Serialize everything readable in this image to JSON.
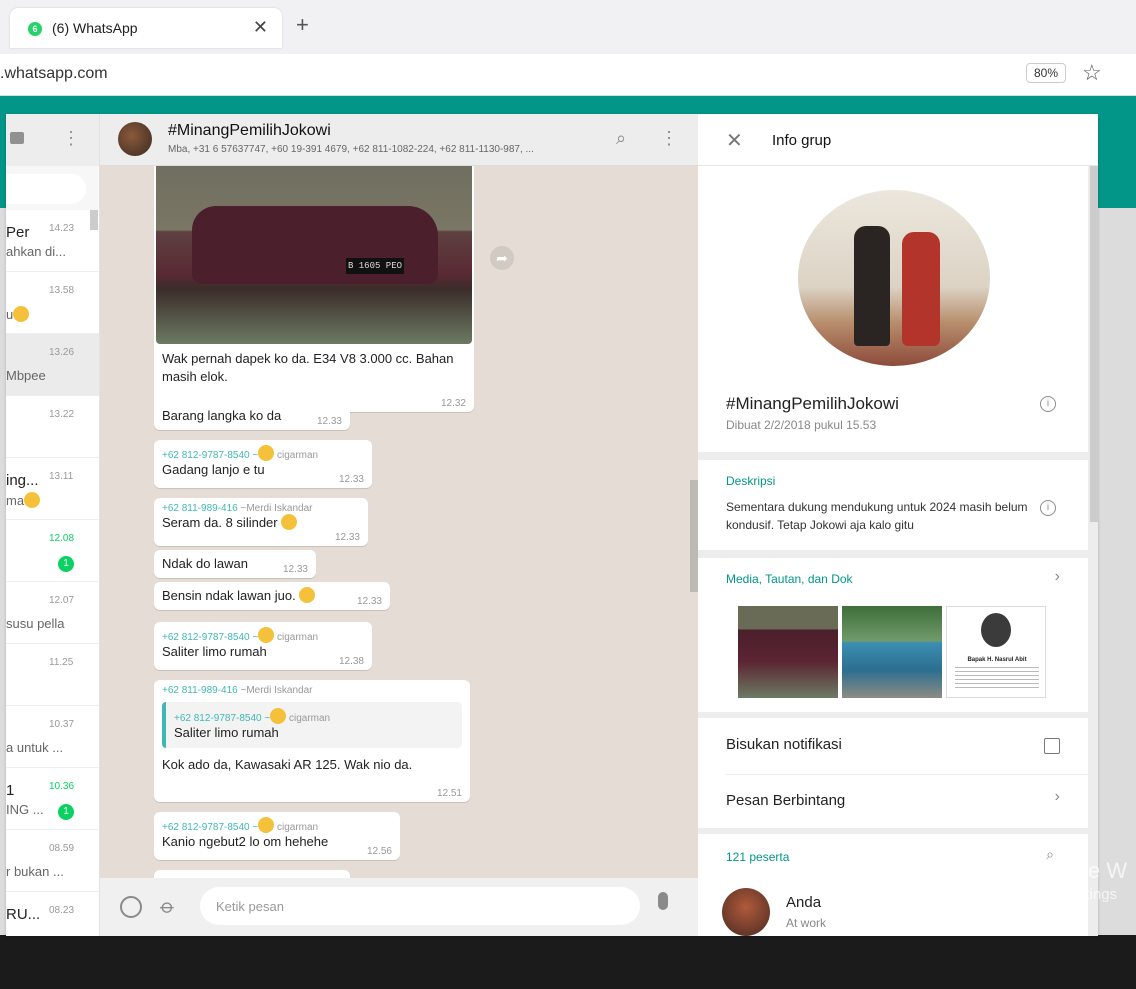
{
  "browser": {
    "tab_title": "(6) WhatsApp",
    "tab_favicon": "6",
    "tab_close": "✕",
    "new_tab": "+",
    "url": ".whatsapp.com",
    "zoom": "80%",
    "star": "☆"
  },
  "sidebar": {
    "menu": "⋮",
    "chats": [
      {
        "name": "Per",
        "time": "14.23",
        "preview": "ahkan di...",
        "unread": "",
        "active": false
      },
      {
        "name": "",
        "time": "13.58",
        "preview": "u",
        "emoji": true,
        "unread": "",
        "active": false
      },
      {
        "name": "",
        "time": "13.26",
        "preview": "Mbpee",
        "unread": "",
        "active": true
      },
      {
        "name": "",
        "time": "13.22",
        "preview": "",
        "unread": "",
        "active": false
      },
      {
        "name": "ing...",
        "time": "13.11",
        "preview": "ma",
        "emoji": true,
        "unread": "",
        "active": false
      },
      {
        "name": "",
        "time": "12.08",
        "preview": "",
        "unread": "1",
        "active": false
      },
      {
        "name": "",
        "time": "12.07",
        "preview": "susu pella",
        "unread": "",
        "active": false
      },
      {
        "name": "",
        "time": "11.25",
        "preview": "",
        "unread": "",
        "active": false
      },
      {
        "name": "",
        "time": "10.37",
        "preview": "a untuk ...",
        "unread": "",
        "active": false
      },
      {
        "name": "1",
        "time": "10.36",
        "preview": "ING ...",
        "unread": "1",
        "active": false
      },
      {
        "name": "",
        "time": "08.59",
        "preview": "r bukan ...",
        "unread": "",
        "active": false
      },
      {
        "name": "RU...",
        "time": "08.23",
        "preview": "",
        "unread": "",
        "active": false
      }
    ]
  },
  "conversation": {
    "title": "#MinangPemilihJokowi",
    "members": "Mba, +31 6 57637747, +60 19-391 4679, +62 811-1082-224, +62 811-1130-987, ...",
    "search": "⌕",
    "menu": "⋮",
    "forward": "➦",
    "plate": "B 1605 PEO",
    "messages": [
      {
        "text": "Wak pernah dapek ko da. E34 V8 3.000 cc. Bahan masih elok.",
        "time": "12.32"
      },
      {
        "text": "Barang langka ko da",
        "time": "12.33"
      },
      {
        "sender": "+62 812-9787-8540",
        "sender_name": "cigarman",
        "text": "Gadang lanjo e tu",
        "time": "12.33"
      },
      {
        "sender": "+62 811-989-416",
        "sender_name": "~Merdi Iskandar",
        "text": "Seram da. 8 silinder",
        "time": "12.33"
      },
      {
        "text": "Ndak do lawan",
        "time": "12.33"
      },
      {
        "text": "Bensin ndak lawan juo.",
        "time": "12.33"
      },
      {
        "sender": "+62 812-9787-8540",
        "sender_name": "cigarman",
        "text": "Saliter limo rumah",
        "time": "12.38"
      },
      {
        "sender": "+62 811-989-416",
        "sender_name": "~Merdi Iskandar",
        "quote_sender": "+62 812-9787-8540",
        "quote_name": "cigarman",
        "quote_text": "Saliter limo rumah",
        "text": "Kok ado da, Kawasaki AR 125. Wak nio da.",
        "time": "12.51"
      },
      {
        "sender": "+62 812-9787-8540",
        "sender_name": "cigarman",
        "text": "Kanio ngebut2 lo om hehehe",
        "time": "12.56"
      }
    ],
    "input_placeholder": "Ketik pesan",
    "attach": "⌀"
  },
  "info": {
    "close": "✕",
    "title": "Info grup",
    "group_name": "#MinangPemilihJokowi",
    "created": "Dibuat 2/2/2018 pukul 15.53",
    "info_glyph": "i",
    "description_label": "Deskripsi",
    "description": "Sementara dukung mendukung untuk 2024 masih belum kondusif. Tetap Jokowi aja kalo gitu",
    "media_label": "Media, Tautan, dan Dok",
    "chevron": "›",
    "thumb3_caption": "Bapak H. Nasrul Abit",
    "mute_label": "Bisukan notifikasi",
    "starred_label": "Pesan Berbintang",
    "participants_label": "121 peserta",
    "participant_search": "⌕",
    "member": {
      "name": "Anda",
      "status": "At work"
    }
  },
  "watermark": {
    "line1": "Activate W",
    "line2": "Go to Settings"
  },
  "colors": {
    "accent": "#009688",
    "header_green": "#019688",
    "unread": "#09d261",
    "chat_bg": "#e5ddd5"
  }
}
